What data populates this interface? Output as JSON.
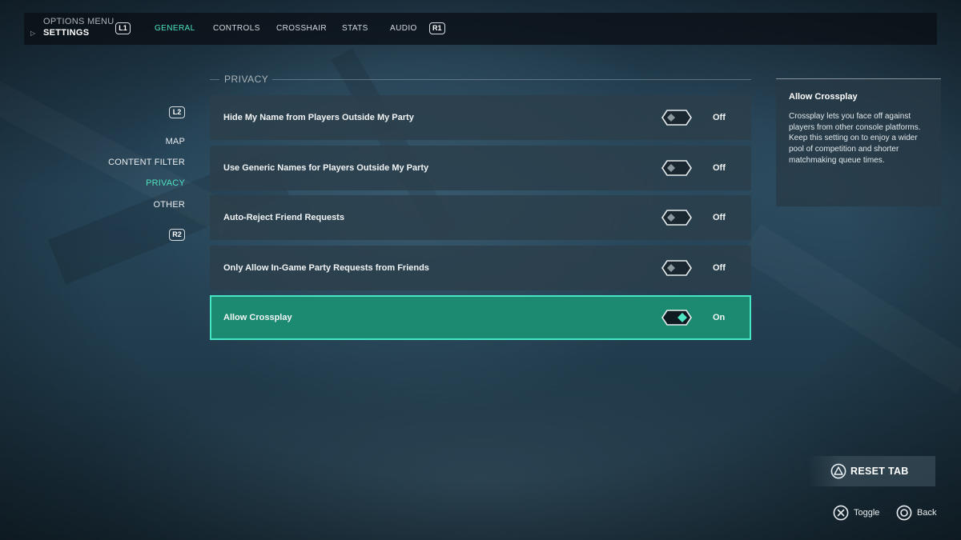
{
  "header": {
    "menu_label": "OPTIONS MENU",
    "current_label": "SETTINGS",
    "prev_tab_button": "L1",
    "next_tab_button": "R1",
    "tabs": [
      {
        "label": "GENERAL",
        "active": true
      },
      {
        "label": "CONTROLS",
        "active": false
      },
      {
        "label": "CROSSHAIR",
        "active": false
      },
      {
        "label": "STATS",
        "active": false
      },
      {
        "label": "AUDIO",
        "active": false
      }
    ]
  },
  "sidebar": {
    "prev_button": "L2",
    "next_button": "R2",
    "items": [
      {
        "label": "MAP",
        "active": false
      },
      {
        "label": "CONTENT FILTER",
        "active": false
      },
      {
        "label": "PRIVACY",
        "active": true
      },
      {
        "label": "OTHER",
        "active": false
      }
    ]
  },
  "section": {
    "title": "PRIVACY",
    "settings": [
      {
        "label": "Hide My Name from Players Outside My Party",
        "value": "Off",
        "on": false,
        "selected": false
      },
      {
        "label": "Use Generic Names for Players Outside My Party",
        "value": "Off",
        "on": false,
        "selected": false
      },
      {
        "label": "Auto-Reject Friend Requests",
        "value": "Off",
        "on": false,
        "selected": false
      },
      {
        "label": "Only Allow In-Game Party Requests from Friends",
        "value": "Off",
        "on": false,
        "selected": false
      },
      {
        "label": "Allow Crossplay",
        "value": "On",
        "on": true,
        "selected": true
      }
    ]
  },
  "info_panel": {
    "title": "Allow Crossplay",
    "description": "Crossplay lets you face off against players from other console platforms. Keep this setting on to enjoy a wider pool of competition and shorter matchmaking queue times."
  },
  "footer": {
    "reset_label": "RESET TAB",
    "toggle_label": "Toggle",
    "back_label": "Back"
  },
  "icons": {
    "reset": "triangle-button-icon",
    "toggle": "cross-button-icon",
    "back": "circle-button-icon",
    "breadcrumb": "play-icon"
  },
  "colors": {
    "accent": "#4ee3c2",
    "selected_row": "#1c8a70",
    "selected_border": "#46e6c4",
    "row_background": "#2c3e4a"
  }
}
